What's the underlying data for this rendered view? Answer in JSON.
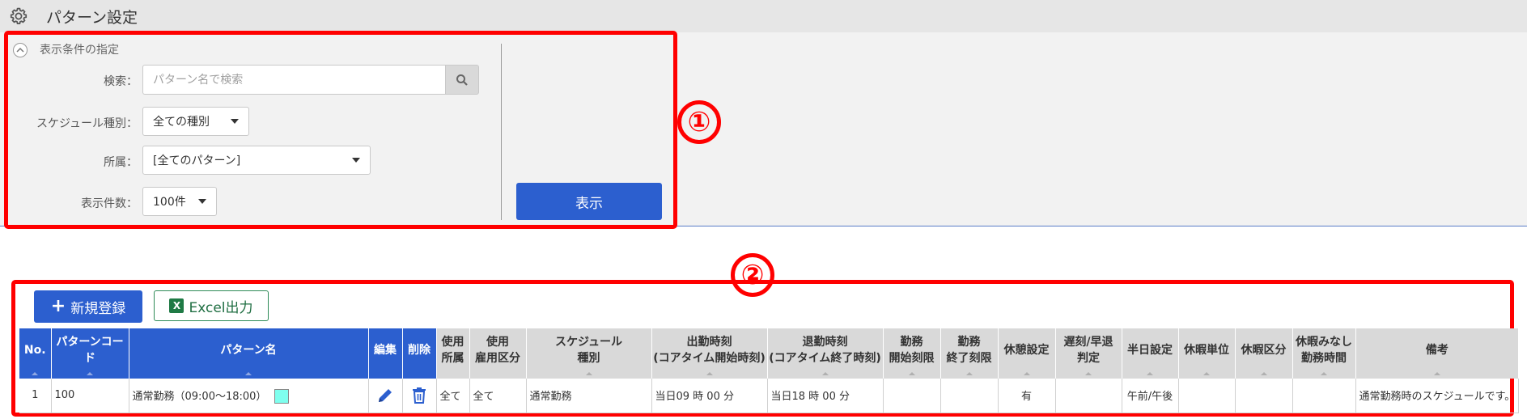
{
  "header": {
    "title": "パターン設定",
    "icon": "gear-icon"
  },
  "conditions": {
    "heading": "表示条件の指定",
    "search_label": "検索：",
    "search_placeholder": "パターン名で検索",
    "schedule_label": "スケジュール種別：",
    "schedule_value": "全ての種別",
    "affiliation_label": "所属：",
    "affiliation_value": "[全てのパターン]",
    "count_label": "表示件数：",
    "count_value": "100件",
    "show_button": "表示"
  },
  "annotations": {
    "one": "①",
    "two": "②"
  },
  "toolbar": {
    "new_plus": "+",
    "new_label": "新規登録",
    "excel_glyph": "X",
    "excel_label": "Excel出力"
  },
  "table": {
    "headers": [
      {
        "l1": "No.",
        "l2": ""
      },
      {
        "l1": "パターンコード",
        "l2": ""
      },
      {
        "l1": "パターン名",
        "l2": ""
      },
      {
        "l1": "編集",
        "l2": ""
      },
      {
        "l1": "削除",
        "l2": ""
      },
      {
        "l1": "使用",
        "l2": "所属"
      },
      {
        "l1": "使用",
        "l2": "雇用区分"
      },
      {
        "l1": "スケジュール",
        "l2": "種別"
      },
      {
        "l1": "出勤時刻",
        "l2": "(コアタイム開始時刻)"
      },
      {
        "l1": "退勤時刻",
        "l2": "(コアタイム終了時刻)"
      },
      {
        "l1": "勤務",
        "l2": "開始刻限"
      },
      {
        "l1": "勤務",
        "l2": "終了刻限"
      },
      {
        "l1": "休憩設定",
        "l2": ""
      },
      {
        "l1": "遅刻/早退",
        "l2": "判定"
      },
      {
        "l1": "半日設定",
        "l2": ""
      },
      {
        "l1": "休暇単位",
        "l2": ""
      },
      {
        "l1": "休暇区分",
        "l2": ""
      },
      {
        "l1": "休暇みなし",
        "l2": "勤務時間"
      },
      {
        "l1": "備考",
        "l2": ""
      }
    ],
    "row": {
      "no": "1",
      "code": "100",
      "name": "通常勤務（09:00～18:00）",
      "color": "#7fffee",
      "affiliation": "全て",
      "employment": "全て",
      "schedule_type": "通常勤務",
      "start_time": "当日09 時 00 分",
      "end_time": "当日18 時 00 分",
      "work_start_limit": "",
      "work_end_limit": "",
      "break_setting": "有",
      "late_early": "",
      "half_day": "午前/午後",
      "leave_unit": "",
      "leave_type": "",
      "leave_deemed": "",
      "remarks": "通常勤務時のスケジュールです。"
    }
  }
}
